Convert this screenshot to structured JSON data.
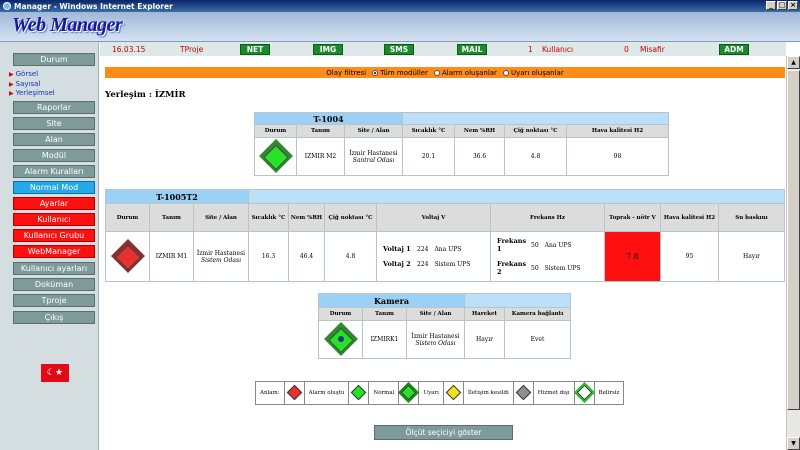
{
  "window": {
    "title": "Manager - Windows Internet Explorer",
    "min": "_",
    "max": "□",
    "close": "×"
  },
  "logo": "Web Manager",
  "sidebar": {
    "durum": "Durum",
    "sublinks": [
      "Görsel",
      "Sayısal",
      "Yerleşimsel"
    ],
    "items": [
      "Raporlar",
      "Site",
      "Alan",
      "Modül",
      "Alarm Kuralları",
      "Normal Mod",
      "Ayarlar",
      "Kullanıcı",
      "Kullanıcı Grubu",
      "WebManager",
      "Kullanıcı ayarları",
      "Doküman",
      "Tproje",
      "Çıkış"
    ],
    "flag": "☾★"
  },
  "topbar": {
    "date": "16.03.15",
    "project": "TProje",
    "net": "NET",
    "img": "IMG",
    "sms": "SMS",
    "mail": "MAIL",
    "user_count": "1",
    "user_label": "Kullanıcı",
    "guest_count": "0",
    "guest_label": "Misafir",
    "adm": "ADM"
  },
  "filter": {
    "label": "Olay filtresi",
    "opt1": "Tüm modüller",
    "opt2": "Alarm oluşanlar",
    "opt3": "Uyarı oluşanlar"
  },
  "location": "Yerleşim : İZMİR",
  "dev1": {
    "title": "T-1004",
    "h": [
      "Durum",
      "Tanım",
      "Site / Alan",
      "Sıcaklık °C",
      "Nem %RH",
      "Çiğ noktası °C",
      "Hava kalitesi H2"
    ],
    "tanim": "IZMIR M2",
    "site": "İzmir Hastanesi",
    "alan": "Santral Odası",
    "sicaklik": "20.1",
    "nem": "36.6",
    "cig": "4.8",
    "hava": "98"
  },
  "dev2": {
    "title": "T-1005T2",
    "h": [
      "Durum",
      "Tanım",
      "Site / Alan",
      "Sıcaklık °C",
      "Nem %RH",
      "Çiğ noktası °C",
      "Voltaj V",
      "Frekans Hz",
      "Toprak - nötr V",
      "Hava kalitesi H2",
      "Su baskını"
    ],
    "tanim": "IZMIR M1",
    "site": "İzmir Hastanesi",
    "alan": "Sistem Odası",
    "sicaklik": "16.3",
    "nem": "46.4",
    "cig": "4.8",
    "v1_label": "Voltaj 1",
    "v1": "224",
    "v1_src": "Ana UPS",
    "v2_label": "Voltaj 2",
    "v2": "224",
    "v2_src": "Sistem UPS",
    "f1_label": "Frekans 1",
    "f1": "50",
    "f1_src": "Ana UPS",
    "f2_label": "Frekans 2",
    "f2": "50",
    "f2_src": "Sistem UPS",
    "toprak": "7.8",
    "hava": "95",
    "su": "Hayır"
  },
  "dev3": {
    "title": "Kamera",
    "h": [
      "Durum",
      "Tanım",
      "Site / Alan",
      "Hareket",
      "Kamera bağlantı"
    ],
    "tanim": "IZMIRK1",
    "site": "İzmir Hastanesi",
    "alan": "Sistem Odası",
    "hareket": "Hayır",
    "baglanti": "Evet"
  },
  "legend": {
    "title": "Anlam:",
    "items": [
      "Alarm oluştu",
      "Normal",
      "Uyarı",
      "İletişim kesildi",
      "Hizmet dışı",
      "Belirsiz"
    ],
    "colors": [
      "#e83030",
      "#28e028",
      "#28e028",
      "#f0e020",
      "#909090",
      "#ffffff"
    ]
  },
  "show_button": "Ölçüt seçiciyi göster"
}
